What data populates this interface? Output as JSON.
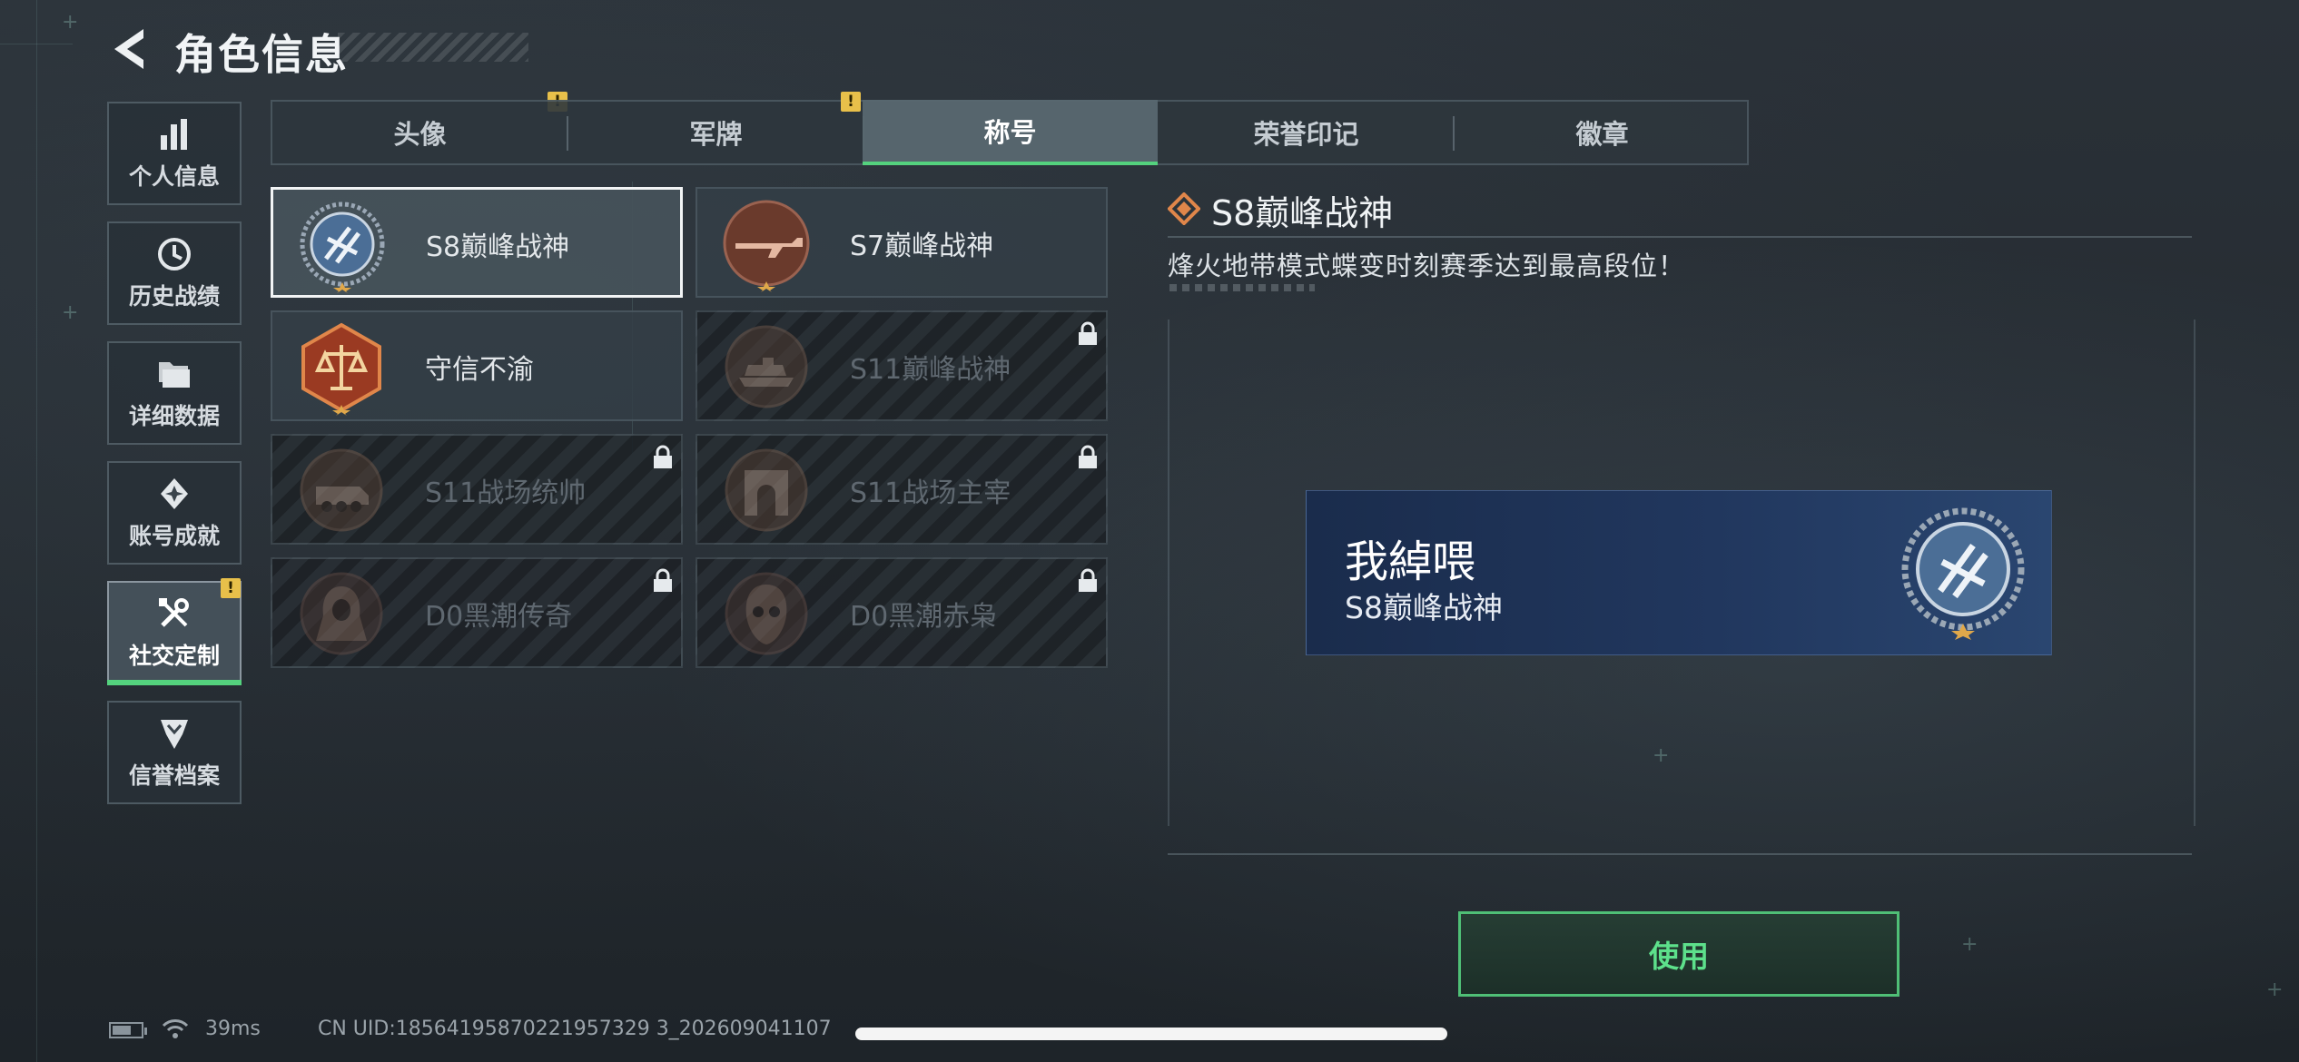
{
  "header": {
    "title": "角色信息"
  },
  "sidebar": {
    "items": [
      {
        "label": "个人信息",
        "icon": "bar-chart-icon",
        "alert": false,
        "active": false
      },
      {
        "label": "历史战绩",
        "icon": "history-clock-icon",
        "alert": false,
        "active": false
      },
      {
        "label": "详细数据",
        "icon": "folder-icon",
        "alert": false,
        "active": false
      },
      {
        "label": "账号成就",
        "icon": "achievement-icon",
        "alert": false,
        "active": false
      },
      {
        "label": "社交定制",
        "icon": "tools-icon",
        "alert": true,
        "active": true
      },
      {
        "label": "信誉档案",
        "icon": "shield-rank-icon",
        "alert": false,
        "active": false
      }
    ],
    "alert_glyph": "!"
  },
  "tabs": [
    {
      "label": "头像",
      "alert": true,
      "active": false
    },
    {
      "label": "军牌",
      "alert": true,
      "active": false
    },
    {
      "label": "称号",
      "alert": false,
      "active": true
    },
    {
      "label": "荣誉印记",
      "alert": false,
      "active": false
    },
    {
      "label": "徽章",
      "alert": false,
      "active": false
    }
  ],
  "titles": [
    {
      "name": "S8巅峰战神",
      "locked": false,
      "selected": true,
      "emblem": "laurel-emblem-icon"
    },
    {
      "name": "S7巅峰战神",
      "locked": false,
      "selected": false,
      "emblem": "rifle-emblem-icon"
    },
    {
      "name": "守信不渝",
      "locked": false,
      "selected": false,
      "emblem": "scales-emblem-icon"
    },
    {
      "name": "S11巅峰战神",
      "locked": true,
      "selected": false,
      "emblem": "tank-emblem-icon"
    },
    {
      "name": "S11战场统帅",
      "locked": true,
      "selected": false,
      "emblem": "armored-car-emblem-icon"
    },
    {
      "name": "S11战场主宰",
      "locked": true,
      "selected": false,
      "emblem": "arch-emblem-icon"
    },
    {
      "name": "D0黑潮传奇",
      "locked": true,
      "selected": false,
      "emblem": "hooded-figure-emblem-icon"
    },
    {
      "name": "D0黑潮赤枭",
      "locked": true,
      "selected": false,
      "emblem": "skull-mask-emblem-icon"
    }
  ],
  "detail": {
    "title": "S8巅峰战神",
    "description": "烽火地带模式蝶变时刻赛季达到最高段位！"
  },
  "preview": {
    "player_name": "我綽喂",
    "title": "S8巅峰战神"
  },
  "actions": {
    "use_label": "使用"
  },
  "status": {
    "ping": "39ms",
    "uid": "CN UID:18564195870221957329 3_202609041107"
  },
  "colors": {
    "accent_green": "#54d27e",
    "alert_yellow": "#e8c04a",
    "namecard_blue": "#21375e"
  }
}
